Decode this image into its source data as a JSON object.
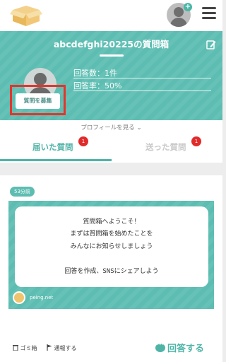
{
  "profile": {
    "title": "abcdefghi20225の質問箱",
    "recruit_label": "質問を募集",
    "answers_label": "回答数：1件",
    "rate_label": "回答率：50%",
    "profile_link": "プロフィールを見る ⌄"
  },
  "tabs": [
    {
      "label": "届いた質問",
      "badge": "1"
    },
    {
      "label": "送った質問",
      "badge": "1"
    }
  ],
  "question": {
    "time": "53分前",
    "lines": [
      "質問箱へようこそ！",
      "まずは質問箱を始めたことを",
      "みんなにお知らせしましょう",
      "",
      "回答を作成、SNSにシェアしよう"
    ],
    "source": "peing.net"
  },
  "actions": {
    "trash": "ゴミ箱",
    "report": "通報する",
    "answer": "回答する"
  },
  "colors": {
    "teal": "#5dbdb2",
    "accent": "#4fb4a7",
    "highlight_red": "#e5342b"
  },
  "icons": [
    "box-logo-icon",
    "avatar-icon",
    "plus-icon",
    "menu-icon",
    "edit-icon",
    "trash-icon",
    "flag-icon",
    "comment-icon"
  ]
}
